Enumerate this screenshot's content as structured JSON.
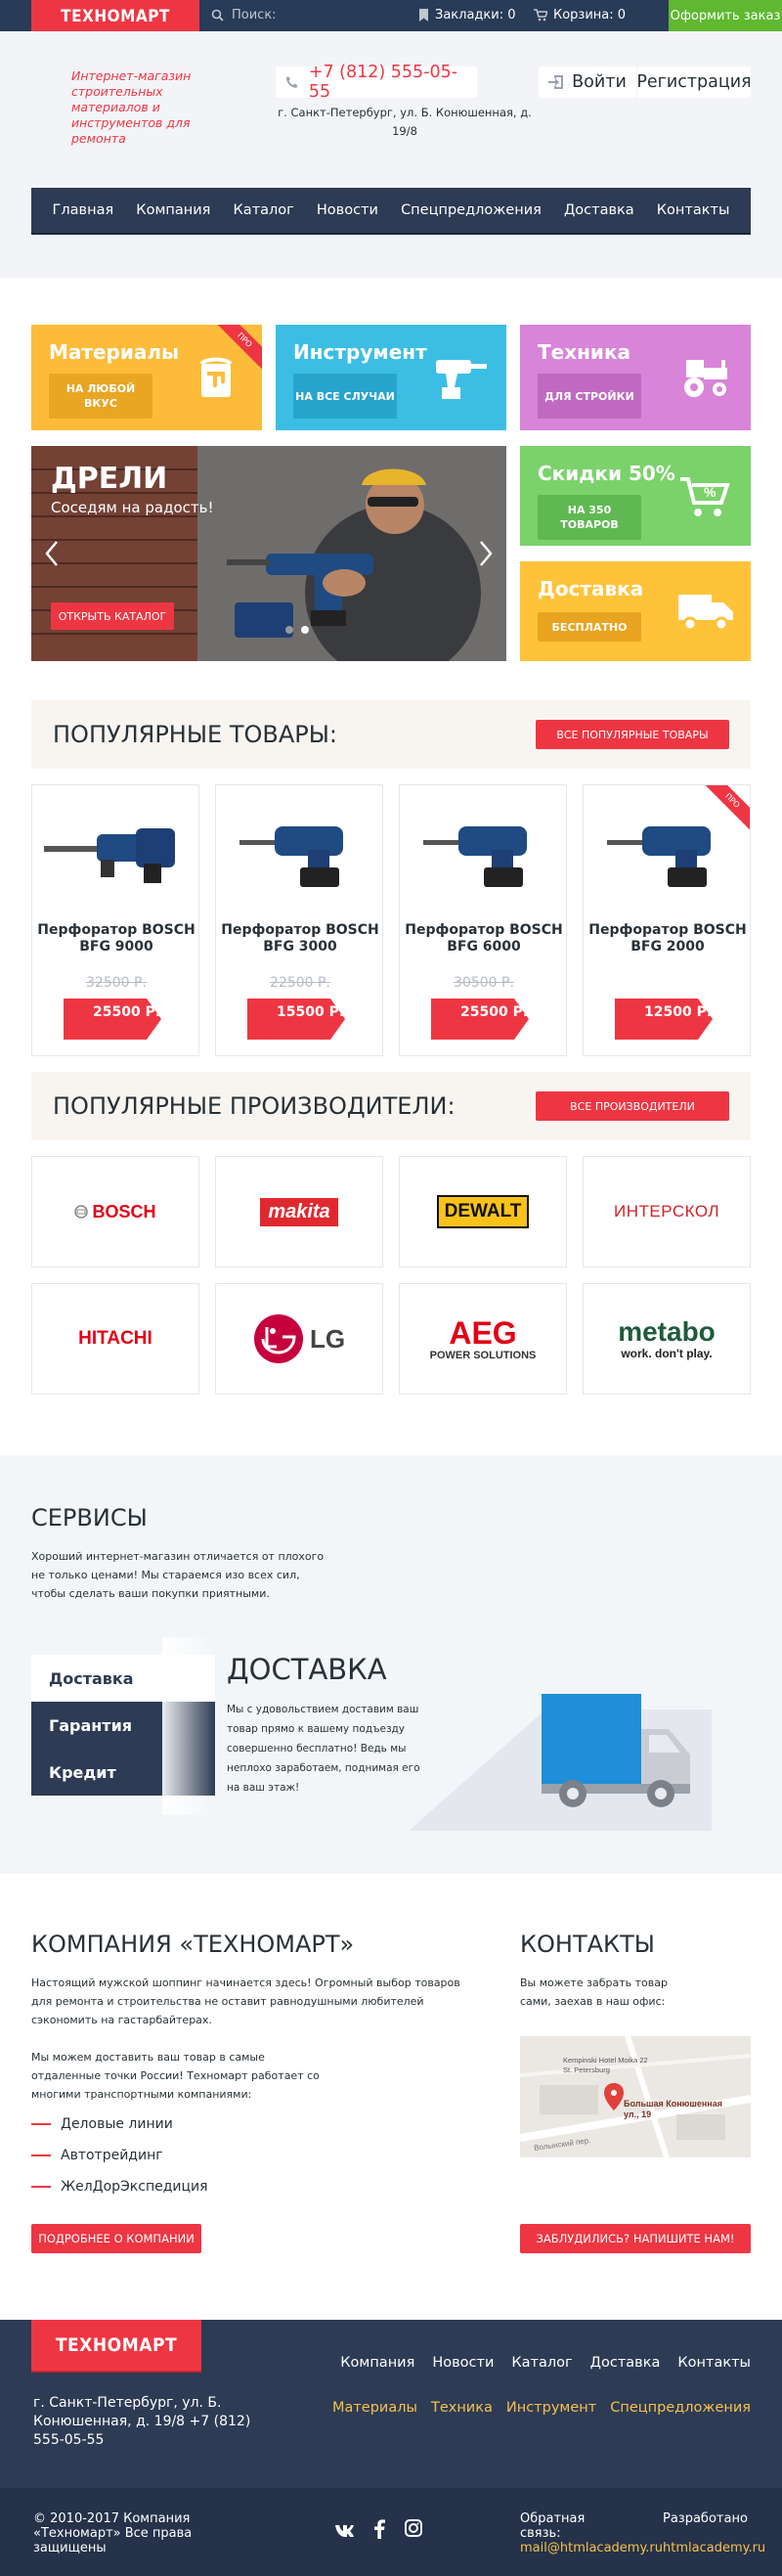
{
  "topbar": {
    "logo": "ТЕХНОМАРТ",
    "search_placeholder": "Поиск:",
    "bookmarks": "Закладки: 0",
    "cart": "Корзина: 0",
    "order": "Оформить заказ"
  },
  "header": {
    "tagline": "Интернет-магазин строительных материалов и инструментов для ремонта",
    "phone": "+7 (812) 555-05-55",
    "address": "г. Санкт-Петербург, ул. Б. Конюшенная, д. 19/8",
    "login": "Войти",
    "register": "Регистрация"
  },
  "nav": [
    "Главная",
    "Компания",
    "Каталог",
    "Новости",
    "Спецпредложения",
    "Доставка",
    "Контакты"
  ],
  "tiles": {
    "materials": {
      "title": "Материалы",
      "button": "НА ЛЮБОЙ ВКУС",
      "ribbon": "ПРО"
    },
    "tools": {
      "title": "Инструмент",
      "button": "НА ВСЕ СЛУЧАИ"
    },
    "machinery": {
      "title": "Техника",
      "button": "ДЛЯ СТРОЙКИ"
    },
    "discounts": {
      "title": "Скидки 50%",
      "button": "НА 350 ТОВАРОВ"
    },
    "delivery": {
      "title": "Доставка",
      "button": "БЕСПЛАТНО"
    }
  },
  "slider": {
    "title": "ДРЕЛИ",
    "subtitle": "Соседям на радость!",
    "button": "ОТКРЫТЬ КАТАЛОГ"
  },
  "popular": {
    "title": "ПОПУЛЯРНЫЕ ТОВАРЫ:",
    "button": "ВСЕ ПОПУЛЯРНЫЕ ТОВАРЫ",
    "products": [
      {
        "name": "Перфоратор BOSCH BFG 9000",
        "old_price": "32500 Р.",
        "price": "25500 Р."
      },
      {
        "name": "Перфоратор BOSCH BFG 3000",
        "old_price": "22500 Р.",
        "price": "15500 Р."
      },
      {
        "name": "Перфоратор BOSCH BFG 6000",
        "old_price": "30500 Р.",
        "price": "25500 Р."
      },
      {
        "name": "Перфоратор BOSCH BFG 2000",
        "old_price": "",
        "price": "12500 Р.",
        "ribbon": "ПРО"
      }
    ]
  },
  "brands": {
    "title": "ПОПУЛЯРНЫЕ ПРОИЗВОДИТЕЛИ:",
    "button": "ВСЕ ПРОИЗВОДИТЕЛИ",
    "items": [
      "BOSCH",
      "makita",
      "DEWALT",
      "ИНТЕРСКОЛ",
      "HITACHI",
      "LG",
      "AEG",
      "metabo"
    ],
    "aeg_sub": "POWER SOLUTIONS",
    "metabo_sub": "work. don't play."
  },
  "services": {
    "title": "СЕРВИСЫ",
    "text": "Хороший интернет-магазин отличается от плохого не только ценами! Мы стараемся изо всех сил, чтобы сделать ваши покупки приятными.",
    "tabs": [
      "Доставка",
      "Гарантия",
      "Кредит"
    ],
    "active_title": "ДОСТАВКА",
    "active_text": "Мы с удовольствием доставим ваш товар прямо к вашему подъезду совершенно бесплатно! Ведь мы неплохо заработаем, поднимая его на ваш этаж!"
  },
  "company": {
    "title": "КОМПАНИЯ «ТЕХНОМАРТ»",
    "p1": "Настоящий мужской шоппинг начинается здесь! Огромный выбор товаров для ремонта и строительства не оставит равнодушными любителей сэкономить на гастарбайтерах.",
    "p2": "Мы можем доставить ваш товар в самые отдаленные точки России! Техномарт работает со многими транспортными компаниями:",
    "carriers": [
      "Деловые линии",
      "Автотрейдинг",
      "ЖелДорЭкспедиция"
    ],
    "button": "ПОДРОБНЕЕ О КОМПАНИИ"
  },
  "contacts": {
    "title": "КОНТАКТЫ",
    "text": "Вы можете забрать товар сами, заехав в наш офис:",
    "map_hotel": "Kempinski Hotel Moika 22 St. Petersburg",
    "map_label": "Большая Конюшенная ул., 19",
    "map_street": "Волынский пер.",
    "button": "ЗАБЛУДИЛИСЬ? НАПИШИТЕ НАМ!"
  },
  "footer": {
    "logo": "ТЕХНОМАРТ",
    "nav": [
      "Компания",
      "Новости",
      "Каталог",
      "Доставка",
      "Контакты"
    ],
    "categories": [
      "Материалы",
      "Техника",
      "Инструмент",
      "Спецпредложения"
    ],
    "address": "г. Санкт-Петербург, ул. Б. Конюшенная, д. 19/8 +7 (812) 555-05-55",
    "copyright": "© 2010-2017 Компания «Техномарт» Все права защищены",
    "feedback_label": "Обратная связь:",
    "feedback_email": "mail@htmlacademy.ru",
    "dev_label": "Разработано",
    "dev_site": "htmlacademy.ru"
  },
  "colors": {
    "accent": "#ee3643",
    "navy": "#2d3b54",
    "green": "#5fb830",
    "yellow": "#fcbc3a",
    "blue": "#3cbee4",
    "purple": "#d884d8",
    "lime": "#7bd26b",
    "orange": "#ffc33a"
  }
}
